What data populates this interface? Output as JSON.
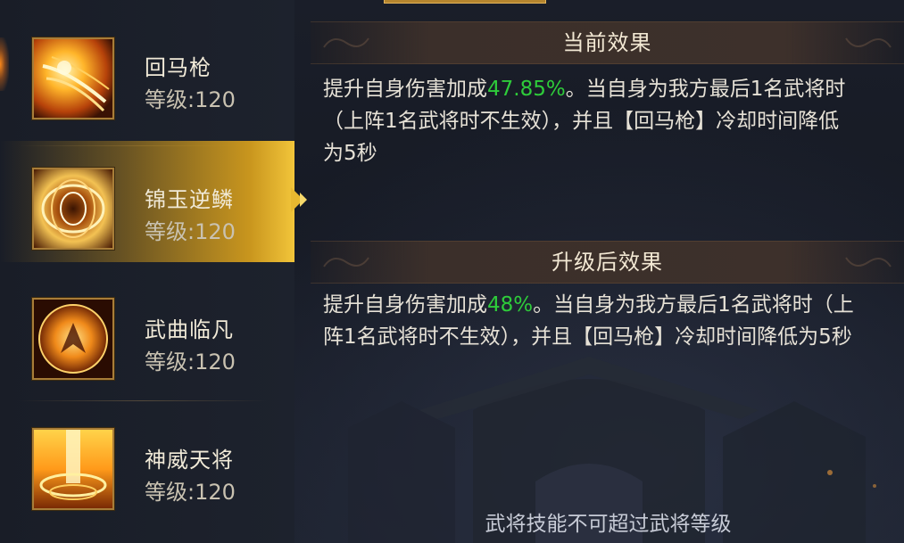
{
  "skills": [
    {
      "name": "回马枪",
      "level": "等级:120",
      "icon": "spear-slash-icon",
      "selected": false
    },
    {
      "name": "锦玉逆鳞",
      "level": "等级:120",
      "icon": "golden-vortex-icon",
      "selected": true
    },
    {
      "name": "武曲临凡",
      "level": "等级:120",
      "icon": "fire-orb-icon",
      "selected": false
    },
    {
      "name": "神威天将",
      "level": "等级:120",
      "icon": "light-pillar-icon",
      "selected": false
    }
  ],
  "current": {
    "title": "当前效果",
    "prefix": "提升自身伤害加成",
    "value": "47.85%",
    "suffix": "。当自身为我方最后1名武将时（上阵1名武将时不生效），并且【回马枪】冷却时间降低为5秒"
  },
  "upgrade": {
    "title": "升级后效果",
    "prefix": "提升自身伤害加成",
    "value": "48%",
    "suffix": "。当自身为我方最后1名武将时（上阵1名武将时不生效），并且【回马枪】冷却时间降低为5秒"
  },
  "footer": "武将技能不可超过武将等级",
  "colors": {
    "highlight": "#2ecc3a",
    "selected_gold": "#f2c53a",
    "text": "#e6e1d6"
  }
}
